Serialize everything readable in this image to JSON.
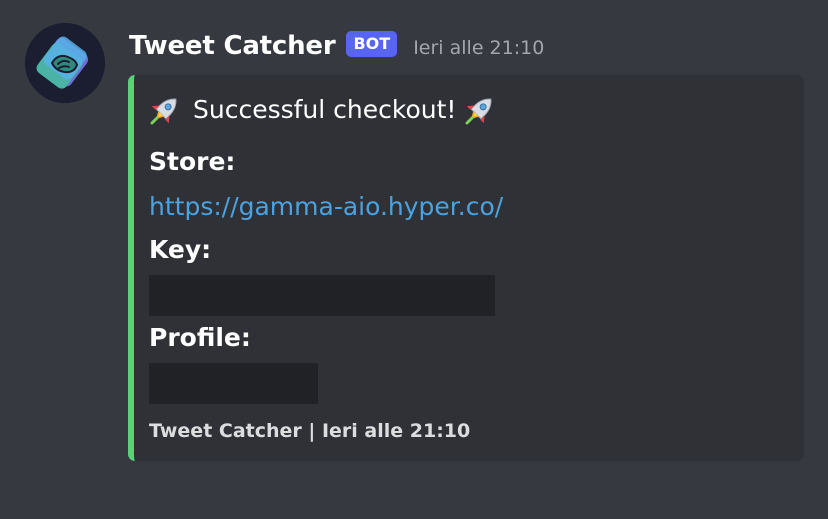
{
  "message": {
    "username": "Tweet Catcher",
    "bot_tag": "BOT",
    "timestamp": "Ieri alle 21:10"
  },
  "embed": {
    "accent_color": "#57d47a",
    "title_prefix_icon": "rocket-emoji",
    "title": "Successful checkout!",
    "title_suffix_icon": "rocket-emoji",
    "fields": [
      {
        "name": "Store:",
        "value": "https://gamma-aio.hyper.co/"
      },
      {
        "name": "Key:",
        "value_redacted": true
      },
      {
        "name": "Profile:",
        "value_redacted": true
      }
    ],
    "footer": "Tweet Catcher | Ieri alle 21:10"
  },
  "colors": {
    "background": "#36393f",
    "embed_background": "#2f3136",
    "bot_tag": "#5865f2",
    "link": "#4aa3e0",
    "redaction": "#202225"
  }
}
